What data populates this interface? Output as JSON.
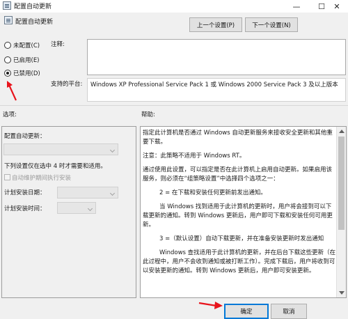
{
  "window": {
    "title": "配置自动更新",
    "minimize_glyph": "—",
    "maximize_glyph": "☐",
    "close_glyph": "✕"
  },
  "header": {
    "title": "配置自动更新",
    "prev_button": "上一个设置(P)",
    "next_button": "下一个设置(N)"
  },
  "state": {
    "options": [
      {
        "label": "未配置(C)",
        "selected": false
      },
      {
        "label": "已启用(E)",
        "selected": false
      },
      {
        "label": "已禁用(D)",
        "selected": true
      }
    ]
  },
  "comment": {
    "label": "注释:",
    "value": ""
  },
  "platform": {
    "label": "支持的平台:",
    "value": "Windows XP Professional Service Pack 1 或 Windows 2000 Service Pack 3 及以上版本"
  },
  "options_pane": {
    "label": "选项:",
    "configure_label": "配置自动更新：",
    "configure_value": "",
    "description": "下列设置仅在选中 4 时才需要和适用。",
    "maintenance_checkbox": "自动维护期间执行安装",
    "install_day_label": "计划安装日期：",
    "install_day_value": "",
    "install_time_label": "计划安装时间：",
    "install_time_value": ""
  },
  "help_pane": {
    "label": "帮助:",
    "paragraphs": [
      "指定此计算机是否通过 Windows 自动更新服务来接收安全更新和其他重要下载。",
      "注意：此策略不适用于 Windows RT。",
      "通过使用此设置，可以指定是否在此计算机上启用自动更新。如果启用该服务，则必须在“组策略设置”中选择四个选项之一：",
      "2 = 在下载和安装任何更新前发出通知。",
      "当 Windows 找到适用于此计算机的更新时，用户将会接到可以下载更新的通知。转到 Windows 更新后，用户即可下载和安装任何可用更新。",
      "3 =（默认设置）自动下载更新，并在准备安装更新时发出通知",
      "Windows 查找适用于此计算机的更新，并在后台下载这些更新（在此过程中，用户不会收到通知或被打断工作）。完成下载后，用户将收到可以安装更新的通知。转到 Windows 更新后，用户即可安装更新。"
    ]
  },
  "footer": {
    "ok_button": "确定",
    "cancel_button": "取消"
  },
  "annotations": {
    "arrow_color": "#e8141c"
  }
}
